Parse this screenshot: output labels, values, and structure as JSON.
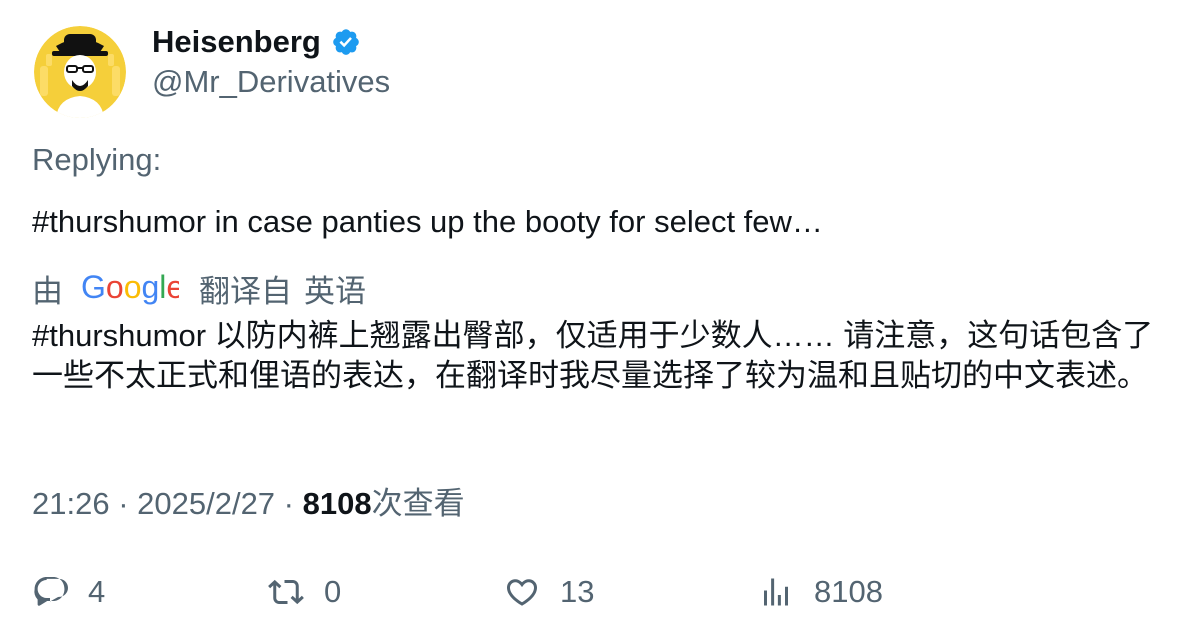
{
  "author": {
    "display_name": "Heisenberg",
    "handle": "@Mr_Derivatives",
    "verified_icon": "verified-badge-icon",
    "verified_color": "#1d9bf0",
    "avatar_bg": "#f5cf3a"
  },
  "replying": {
    "label": "Replying:"
  },
  "tweet": {
    "text": "#thurshumor in case panties up the booty for select few…"
  },
  "translation": {
    "by_label": "由",
    "provider_logo": "google-logo",
    "provider_text": "Google",
    "from_label": "翻译自",
    "language": "英语",
    "text": "#thurshumor 以防内裤上翘露出臀部，仅适用于少数人…… 请注意，这句话包含了一些不太正式和俚语的表达，在翻译时我尽量选择了较为温和且贴切的中文表述。"
  },
  "meta": {
    "time": "21:26",
    "separator": " · ",
    "date": "2025/2/27",
    "views_count": "8108",
    "views_label": "次查看"
  },
  "actions": {
    "reply_count": "4",
    "retweet_count": "0",
    "like_count": "13",
    "views_count": "8108"
  },
  "colors": {
    "text_primary": "#0f1419",
    "text_secondary": "#536471",
    "google_blue": "#4285f4",
    "google_red": "#ea4335",
    "google_yellow": "#fbbc05",
    "google_green": "#34a853"
  }
}
